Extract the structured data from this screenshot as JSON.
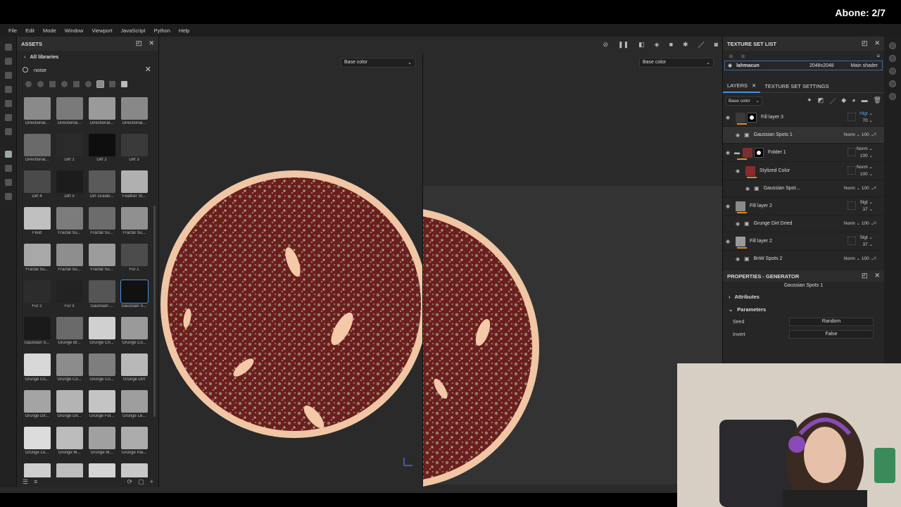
{
  "stream_label": "Abone: 2/7",
  "menu": [
    "File",
    "Edit",
    "Mode",
    "Window",
    "Viewport",
    "JavaScript",
    "Python",
    "Help"
  ],
  "assets": {
    "title": "ASSETS",
    "library": "All libraries",
    "search_value": "noise",
    "items": [
      {
        "label": "Directional...",
        "tone": "#8a8a8a"
      },
      {
        "label": "Directional...",
        "tone": "#7a7a7a"
      },
      {
        "label": "Directional...",
        "tone": "#9a9a9a"
      },
      {
        "label": "Directional...",
        "tone": "#888888"
      },
      {
        "label": "Directional...",
        "tone": "#6a6a6a"
      },
      {
        "label": "Dirt 1",
        "tone": "#2a2a2a"
      },
      {
        "label": "Dirt 2",
        "tone": "#0e0e0e"
      },
      {
        "label": "Dirt 3",
        "tone": "#3a3a3a"
      },
      {
        "label": "Dirt 4",
        "tone": "#4a4a4a"
      },
      {
        "label": "Dirt 5",
        "tone": "#1c1c1c"
      },
      {
        "label": "Dirt Gradie...",
        "tone": "#5a5a5a"
      },
      {
        "label": "Feather St...",
        "tone": "#b0b0b0"
      },
      {
        "label": "Fluid",
        "tone": "#c0c0c0"
      },
      {
        "label": "Fractal Su...",
        "tone": "#7c7c7c"
      },
      {
        "label": "Fractal Su...",
        "tone": "#6c6c6c"
      },
      {
        "label": "Fractal Su...",
        "tone": "#909090"
      },
      {
        "label": "Fractal Su...",
        "tone": "#a8a8a8"
      },
      {
        "label": "Fractal Su...",
        "tone": "#8e8e8e"
      },
      {
        "label": "Fractal Su...",
        "tone": "#9c9c9c"
      },
      {
        "label": "Fur 1",
        "tone": "#4c4c4c"
      },
      {
        "label": "Fur 2",
        "tone": "#2c2c2c"
      },
      {
        "label": "Fur 3",
        "tone": "#222222"
      },
      {
        "label": "Gaussian ...",
        "tone": "#555555"
      },
      {
        "label": "Gaussian S...",
        "tone": "#111111"
      },
      {
        "label": "Gaussian S...",
        "tone": "#1a1a1a"
      },
      {
        "label": "Grunge Br...",
        "tone": "#6a6a6a"
      },
      {
        "label": "Grunge Ch...",
        "tone": "#d0d0d0"
      },
      {
        "label": "Grunge Co...",
        "tone": "#9a9a9a"
      },
      {
        "label": "Grunge Co...",
        "tone": "#d8d8d8"
      },
      {
        "label": "Grunge Co...",
        "tone": "#8c8c8c"
      },
      {
        "label": "Grunge Co...",
        "tone": "#7e7e7e"
      },
      {
        "label": "Grunge Dirt",
        "tone": "#b8b8b8"
      },
      {
        "label": "Grunge Dir...",
        "tone": "#a4a4a4"
      },
      {
        "label": "Grunge Dir...",
        "tone": "#b4b4b4"
      },
      {
        "label": "Grunge Fol...",
        "tone": "#c4c4c4"
      },
      {
        "label": "Grunge Le...",
        "tone": "#9e9e9e"
      },
      {
        "label": "Grunge Le...",
        "tone": "#dcdcdc"
      },
      {
        "label": "Grunge M...",
        "tone": "#bcbcbc"
      },
      {
        "label": "Grunge M...",
        "tone": "#a0a0a0"
      },
      {
        "label": "Grunge Pai...",
        "tone": "#acacac"
      },
      {
        "label": "",
        "tone": "#cfcfcf"
      },
      {
        "label": "",
        "tone": "#bdbdbd"
      },
      {
        "label": "",
        "tone": "#d4d4d4"
      },
      {
        "label": "",
        "tone": "#c8c8c8"
      }
    ],
    "selected_index": 23
  },
  "viewport": {
    "left_channel": "Base color",
    "right_channel": "Base color"
  },
  "texture_set_list": {
    "title": "TEXTURE SET LIST",
    "name": "lahmacun",
    "resolution": "2048x2048",
    "shader": "Main shader"
  },
  "layers_panel": {
    "tab_layers": "LAYERS",
    "tab_settings": "TEXTURE SET SETTINGS",
    "channel": "Base color",
    "layers": [
      {
        "name": "Fill layer 3",
        "blend": "Hlgt",
        "opacity": "70",
        "sub": false,
        "highlight": true,
        "icon": "#3a3a3a",
        "mask": true
      },
      {
        "name": "Gaussian Spots 1",
        "blend": "Norm",
        "opacity": "100",
        "sub": true,
        "selected": true
      },
      {
        "name": "Folder 1",
        "blend": "Norm",
        "opacity": "100",
        "sub": false,
        "icon": "#7a3030",
        "mask": true,
        "folder": true
      },
      {
        "name": "Stylized Color",
        "blend": "Norm",
        "opacity": "100",
        "sub": false,
        "icon": "#8a2a2a",
        "indent": true
      },
      {
        "name": "Gaussian Spot...",
        "blend": "Norm",
        "opacity": "100",
        "sub": true,
        "indent": true
      },
      {
        "name": "Fill layer 2",
        "blend": "Slgt",
        "opacity": "37",
        "sub": false,
        "icon": "#8a8a8a"
      },
      {
        "name": "Grunge Dirt Dried",
        "blend": "Norm",
        "opacity": "100",
        "sub": true
      },
      {
        "name": "Fill layer 2",
        "blend": "Slgt",
        "opacity": "37",
        "sub": false,
        "icon": "#9a9a9a"
      },
      {
        "name": "BnW Spots 2",
        "blend": "Norm",
        "opacity": "100",
        "sub": true
      }
    ]
  },
  "properties": {
    "title": "PROPERTIES - GENERATOR",
    "generator": "Gaussian Spots 1",
    "section_attributes": "Attributes",
    "section_parameters": "Parameters",
    "seed_label": "Seed",
    "seed_value": "Random",
    "invert_label": "Invert",
    "invert_value": "False"
  },
  "colors": {
    "accent": "#4a90d9",
    "pizza_base": "#f3c9a8",
    "topping": "#6b1f1c",
    "crust": "#f0c6a4"
  }
}
